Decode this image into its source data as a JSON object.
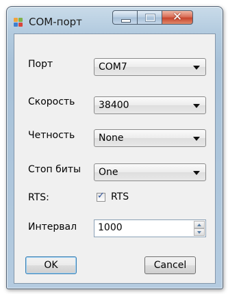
{
  "window": {
    "title": "COM-порт",
    "close_glyph": "✕"
  },
  "fields": {
    "port_label": "Порт",
    "port_value": "COM7",
    "speed_label": "Скорость",
    "speed_value": "38400",
    "parity_label": "Четность",
    "parity_value": "None",
    "stopbits_label": "Стоп биты",
    "stopbits_value": "One",
    "rts_label": "RTS:",
    "rts_checkbox_label": "RTS",
    "rts_checked": true,
    "interval_label": "Интервал",
    "interval_value": "1000"
  },
  "buttons": {
    "ok": "OK",
    "cancel": "Cancel"
  },
  "icons": {
    "app": "app-window-icon",
    "minimize": "minimize-icon",
    "maximize": "maximize-icon",
    "close": "close-icon",
    "dropdown": "chevron-down-icon",
    "check": "checkmark-icon",
    "spin_up": "spin-up-icon",
    "spin_down": "spin-down-icon"
  }
}
